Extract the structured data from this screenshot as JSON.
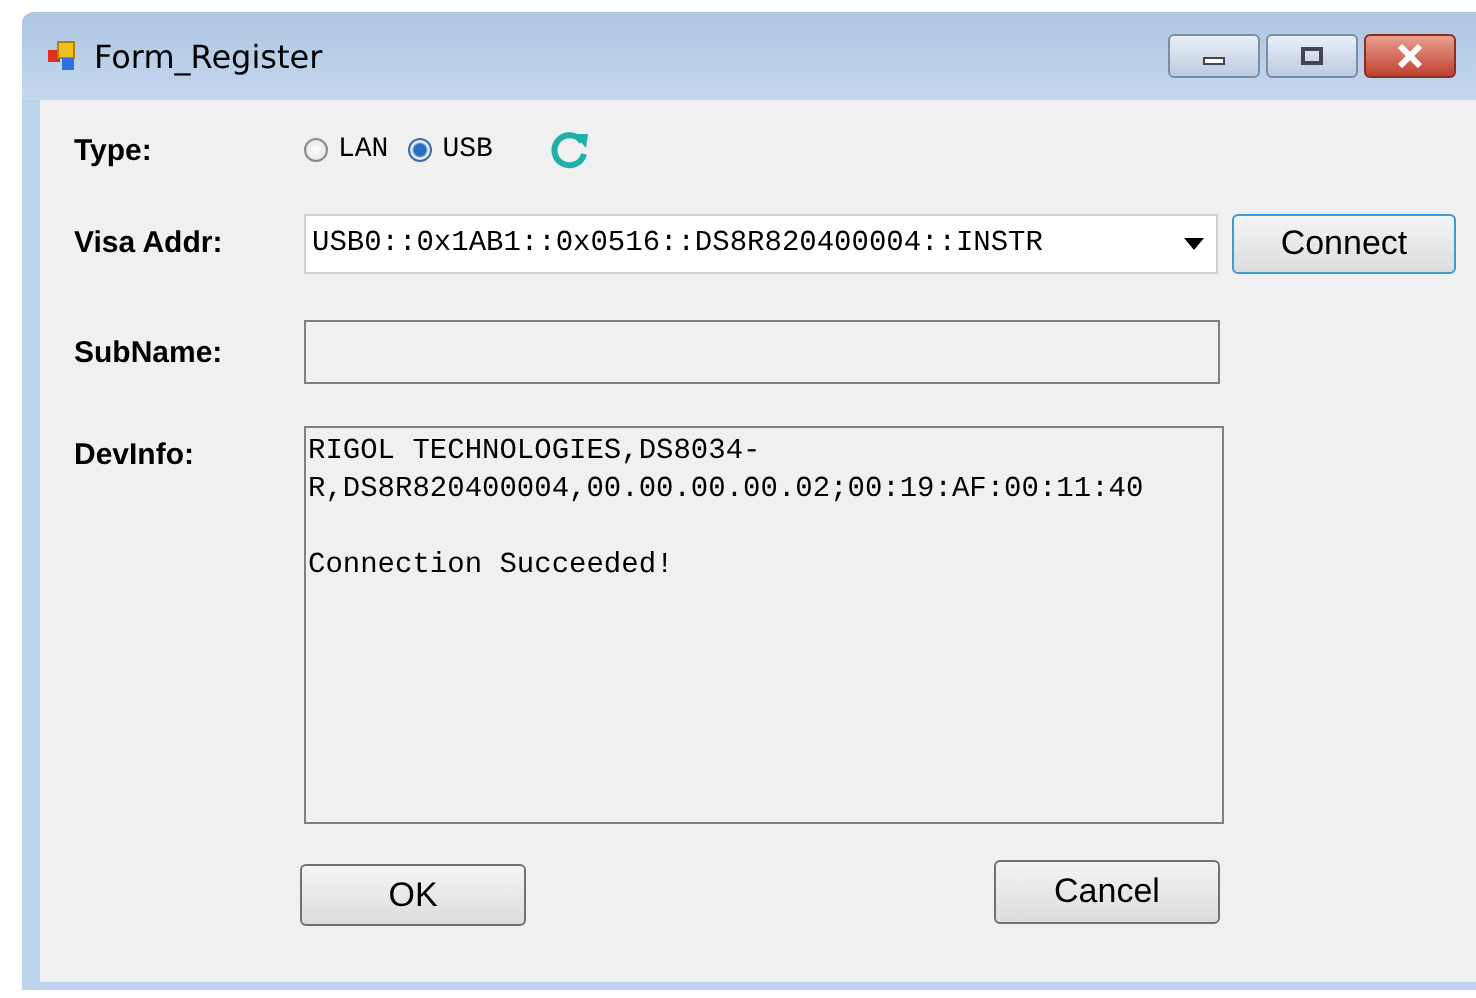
{
  "window": {
    "title": "Form_Register"
  },
  "type": {
    "label": "Type:",
    "options": [
      {
        "label": "LAN",
        "selected": false
      },
      {
        "label": "USB",
        "selected": true
      }
    ]
  },
  "visa_addr": {
    "label": "Visa Addr:",
    "value": "USB0::0x1AB1::0x0516::DS8R820400004::INSTR",
    "button": "Connect"
  },
  "subname": {
    "label": "SubName:"
  },
  "devinfo": {
    "label": "DevInfo:",
    "paragraphs": [
      [
        "RIGOL TECHNOLOGIES,DS8034-",
        "R,DS8R820400004,00.00.00.00.02;00:19:AF:00:11:40"
      ],
      [
        "Connection Succeeded!"
      ]
    ]
  },
  "buttons": [
    "OK",
    "Cancel"
  ]
}
